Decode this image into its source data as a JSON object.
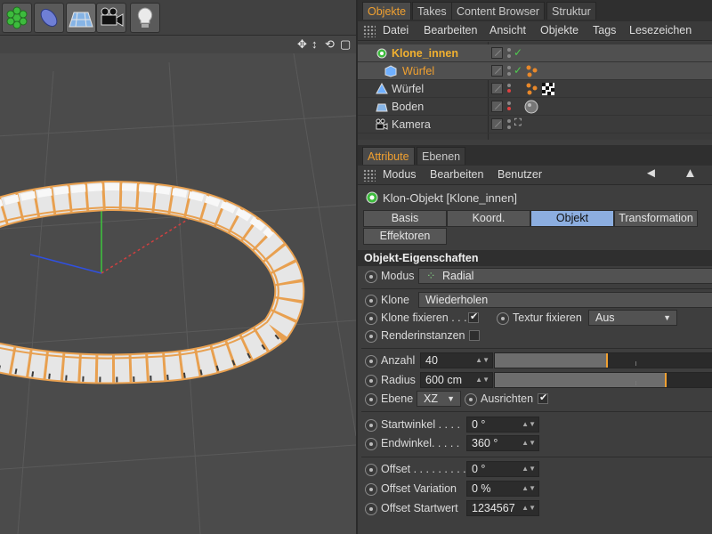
{
  "toolbar": {
    "icons": [
      "cloner-icon",
      "deformer-icon",
      "floor-icon",
      "camera-icon",
      "light-icon"
    ]
  },
  "object_manager": {
    "tabs": [
      "Objekte",
      "Takes",
      "Content Browser",
      "Struktur"
    ],
    "menu": [
      "Datei",
      "Bearbeiten",
      "Ansicht",
      "Objekte",
      "Tags",
      "Lesezeichen"
    ],
    "rows": [
      {
        "name": "Klone_innen",
        "color": "#f0b030"
      },
      {
        "name": "Würfel",
        "color": "#f0a030"
      },
      {
        "name": "Würfel",
        "color": "#d8d8d8"
      },
      {
        "name": "Boden",
        "color": "#d8d8d8"
      },
      {
        "name": "Kamera",
        "color": "#d8d8d8"
      }
    ]
  },
  "attributes": {
    "tabs": [
      "Attribute",
      "Ebenen"
    ],
    "menu": [
      "Modus",
      "Bearbeiten",
      "Benutzer"
    ],
    "object_title": "Klon-Objekt [Klone_innen]",
    "subtabs": [
      "Basis",
      "Koord.",
      "Objekt",
      "Transformation",
      "Effektoren"
    ],
    "active_subtab": "Objekt",
    "section": "Objekt-Eigenschaften",
    "modus_label": "Modus",
    "modus_value": "Radial",
    "klone_label": "Klone",
    "klone_value": "Wiederholen",
    "klone_fixieren_label": "Klone fixieren . . .",
    "klone_fixieren_checked": true,
    "textur_fixieren_label": "Textur fixieren",
    "textur_fixieren_value": "Aus",
    "renderinstanzen_label": "Renderinstanzen",
    "renderinstanzen_checked": false,
    "anzahl_label": "Anzahl",
    "anzahl_value": "40",
    "anzahl_slider_fraction": 0.51,
    "radius_label": "Radius",
    "radius_value": "600 cm",
    "radius_slider_fraction": 0.78,
    "ebene_label": "Ebene",
    "ebene_value": "XZ",
    "ausrichten_label": "Ausrichten",
    "ausrichten_checked": true,
    "startwinkel_label": "Startwinkel . . . .",
    "startwinkel_value": "0 °",
    "endwinkel_label": "Endwinkel. . . . .",
    "endwinkel_value": "360 °",
    "offset_label": "Offset . . . . . . . . .",
    "offset_value": "0 °",
    "offset_variation_label": "Offset Variation",
    "offset_variation_value": "0 %",
    "offset_startwert_label": "Offset Startwert",
    "offset_startwert_value": "1234567"
  },
  "colors": {
    "accent": "#f0a030",
    "active_button": "#8caee0",
    "selection_outline": "#e8a050"
  }
}
